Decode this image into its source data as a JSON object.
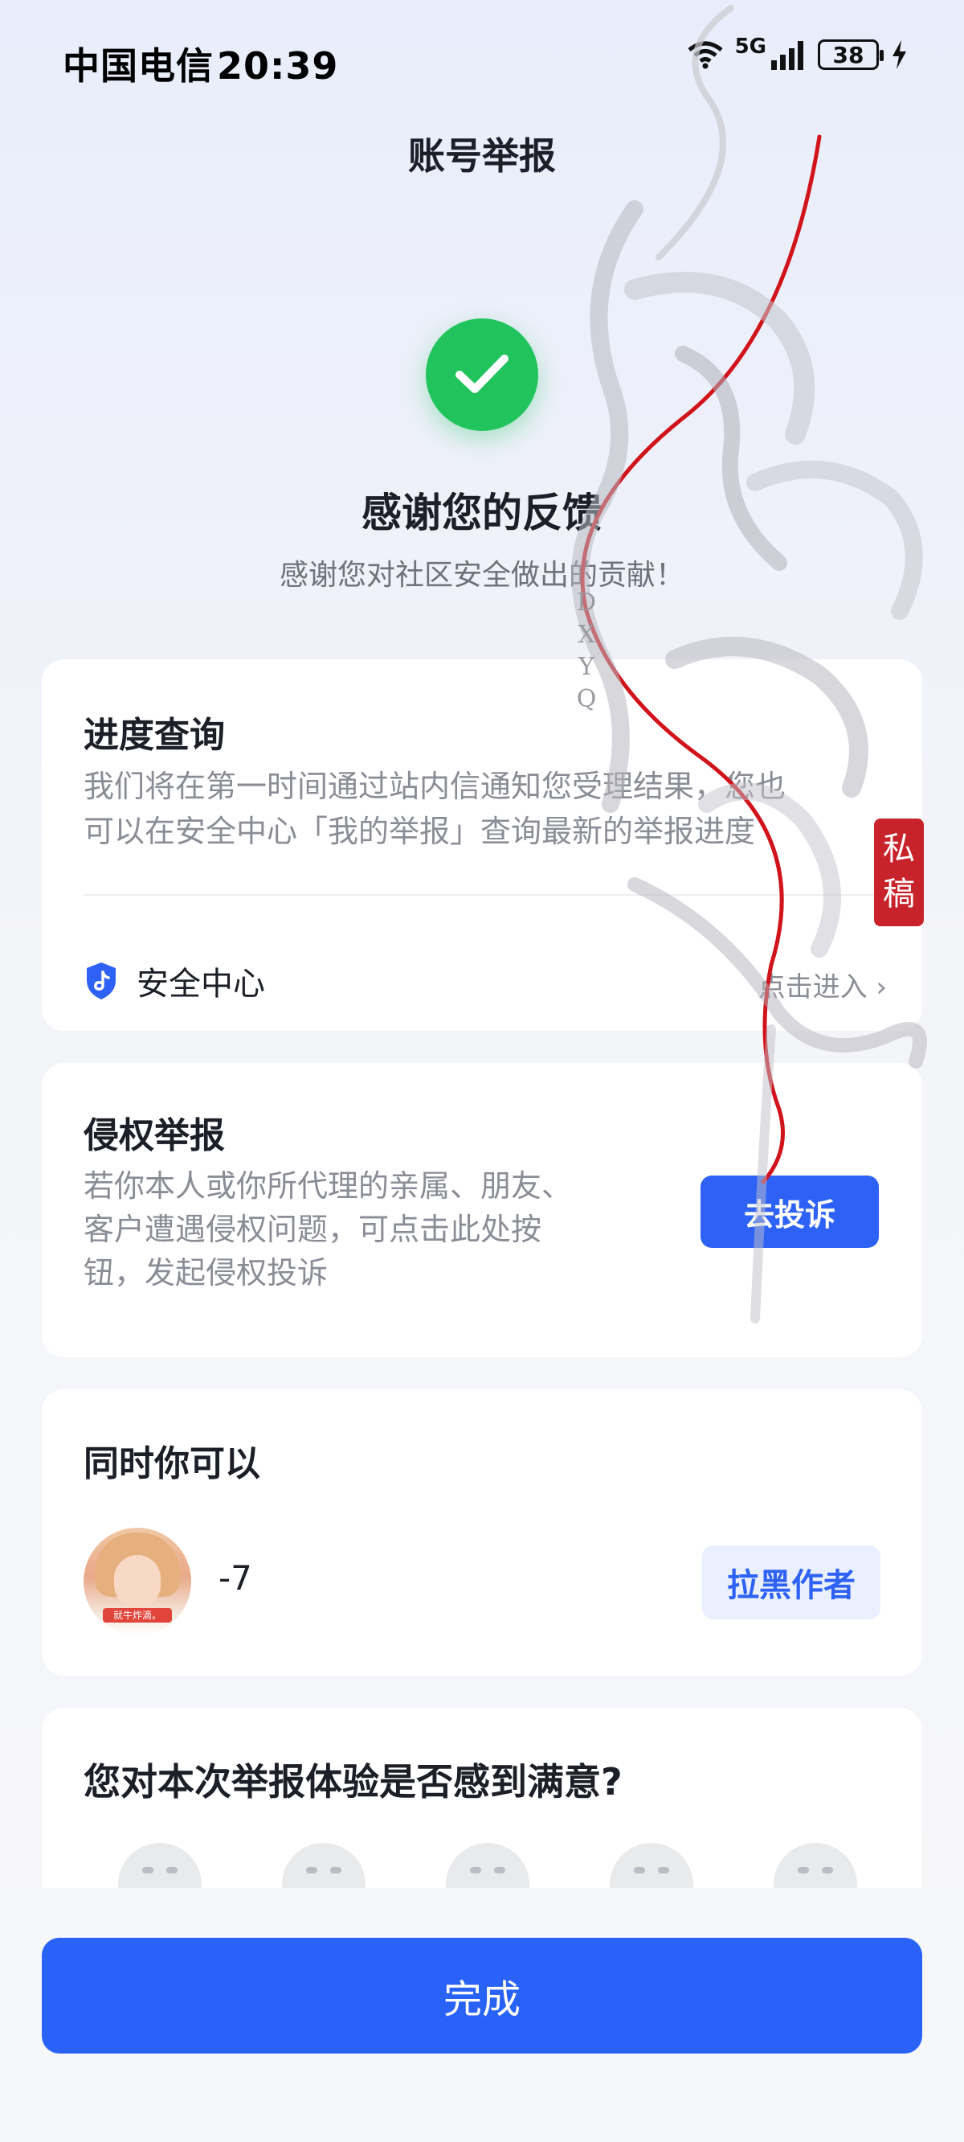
{
  "status_bar": {
    "carrier": "中国电信",
    "time": "20:39",
    "network": "5G",
    "battery": "38",
    "icons": [
      "wifi-icon",
      "signal-icon",
      "battery-icon",
      "charging-icon"
    ]
  },
  "header": {
    "title": "账号举报"
  },
  "result": {
    "icon": "check-circle-icon",
    "title": "感谢您的反馈",
    "subtitle": "感谢您对社区安全做出的贡献！"
  },
  "progress_card": {
    "title": "进度查询",
    "desc_line1": "我们将在第一时间通过站内信通知您受理结果，您也",
    "desc_line2": "可以在安全中心「我的举报」查询最新的举报进度",
    "security_label": "安全中心",
    "enter_label": "点击进入",
    "enter_icon": "chevron-right-icon"
  },
  "rights_card": {
    "title": "侵权举报",
    "desc_line1": "若你本人或你所代理的亲属、朋友、",
    "desc_line2": "客户遭遇侵权问题，可点击此处按",
    "desc_line3": "钮，发起侵权投诉",
    "button": "去投诉"
  },
  "also_card": {
    "title": "同时你可以",
    "author_name": "-7",
    "avatar_tag": "就牛炸滴。",
    "block_button": "拉黑作者"
  },
  "survey": {
    "title": "您对本次举报体验是否感到满意?",
    "faces": [
      "very-unsatisfied-face-icon",
      "unsatisfied-face-icon",
      "neutral-face-icon",
      "satisfied-face-icon",
      "very-satisfied-face-icon"
    ]
  },
  "footer": {
    "done_button": "完成"
  },
  "watermark": {
    "letters": [
      "D",
      "X",
      "Y",
      "Q"
    ],
    "seal_text_1": "私",
    "seal_text_2": "稿"
  },
  "colors": {
    "primary": "#2862f6",
    "success": "#21c45c",
    "seal": "#c8222a"
  }
}
